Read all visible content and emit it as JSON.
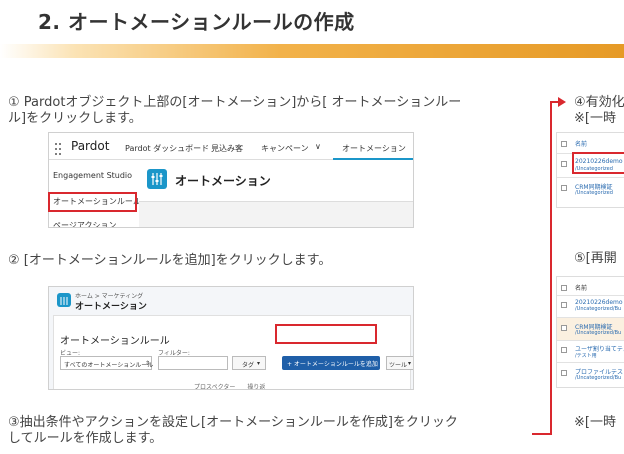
{
  "heading": "2. オートメーションルールの作成",
  "step1": {
    "line1": "① Pardotオブジェクト上部の[オートメーション]から[ オートメーションルー",
    "line2": "ル]をクリックします。"
  },
  "nav": {
    "brand": "Pardot",
    "items": [
      "Pardot ダッシュボード",
      "見込み客",
      "キャンペーン",
      "オートメーション"
    ],
    "dropdown": [
      "Engagement Studio",
      "オートメーションルール",
      "ページアクション"
    ],
    "header": "オートメーション"
  },
  "step2": "② [オートメーションルールを追加]をクリックします。",
  "panel": {
    "breadcrumb": "ホーム > マーケティング",
    "title": "オートメーション",
    "section": "オートメーションルール",
    "view_label": "ビュー:",
    "filter_label": "フィルター:",
    "select_value": "すべてのオートメーションルール",
    "tag_label": "タグ",
    "add_button": "+ オートメーションルールを追加",
    "tools_label": "ツール",
    "footer_link": "プロスペクター　　操り返"
  },
  "step3": {
    "line1": "③抽出条件やアクションを設定し[オートメーションルールを作成]をクリック",
    "line2": "してルールを作成します。"
  },
  "right": {
    "step4": "④有効化",
    "note1": "※[一時",
    "list1_header": "名前",
    "list1_rows": [
      {
        "name": "20210226demo",
        "folder": "/Uncategorized"
      },
      {
        "name": "CRM同期検証",
        "folder": "/Uncategorized"
      }
    ],
    "step5": "⑤[再開",
    "list2_header": "名前",
    "list2_rows": [
      {
        "name": "20210226demo",
        "folder": "/Uncategorized/Bu"
      },
      {
        "name": "CRM同期検証",
        "folder": "/Uncategorized/Bu"
      },
      {
        "name": "ユーザ割り当てテスト",
        "folder": "/テスト用"
      },
      {
        "name": "プロファイルテスト停止中",
        "folder": "/Uncategorized/Bu"
      }
    ],
    "note2": "※[一時"
  },
  "colors": {
    "accent": "#d9282e",
    "orange": "#e69a26",
    "pardot_blue": "#1b96c9",
    "button_blue": "#1f5fa8"
  }
}
